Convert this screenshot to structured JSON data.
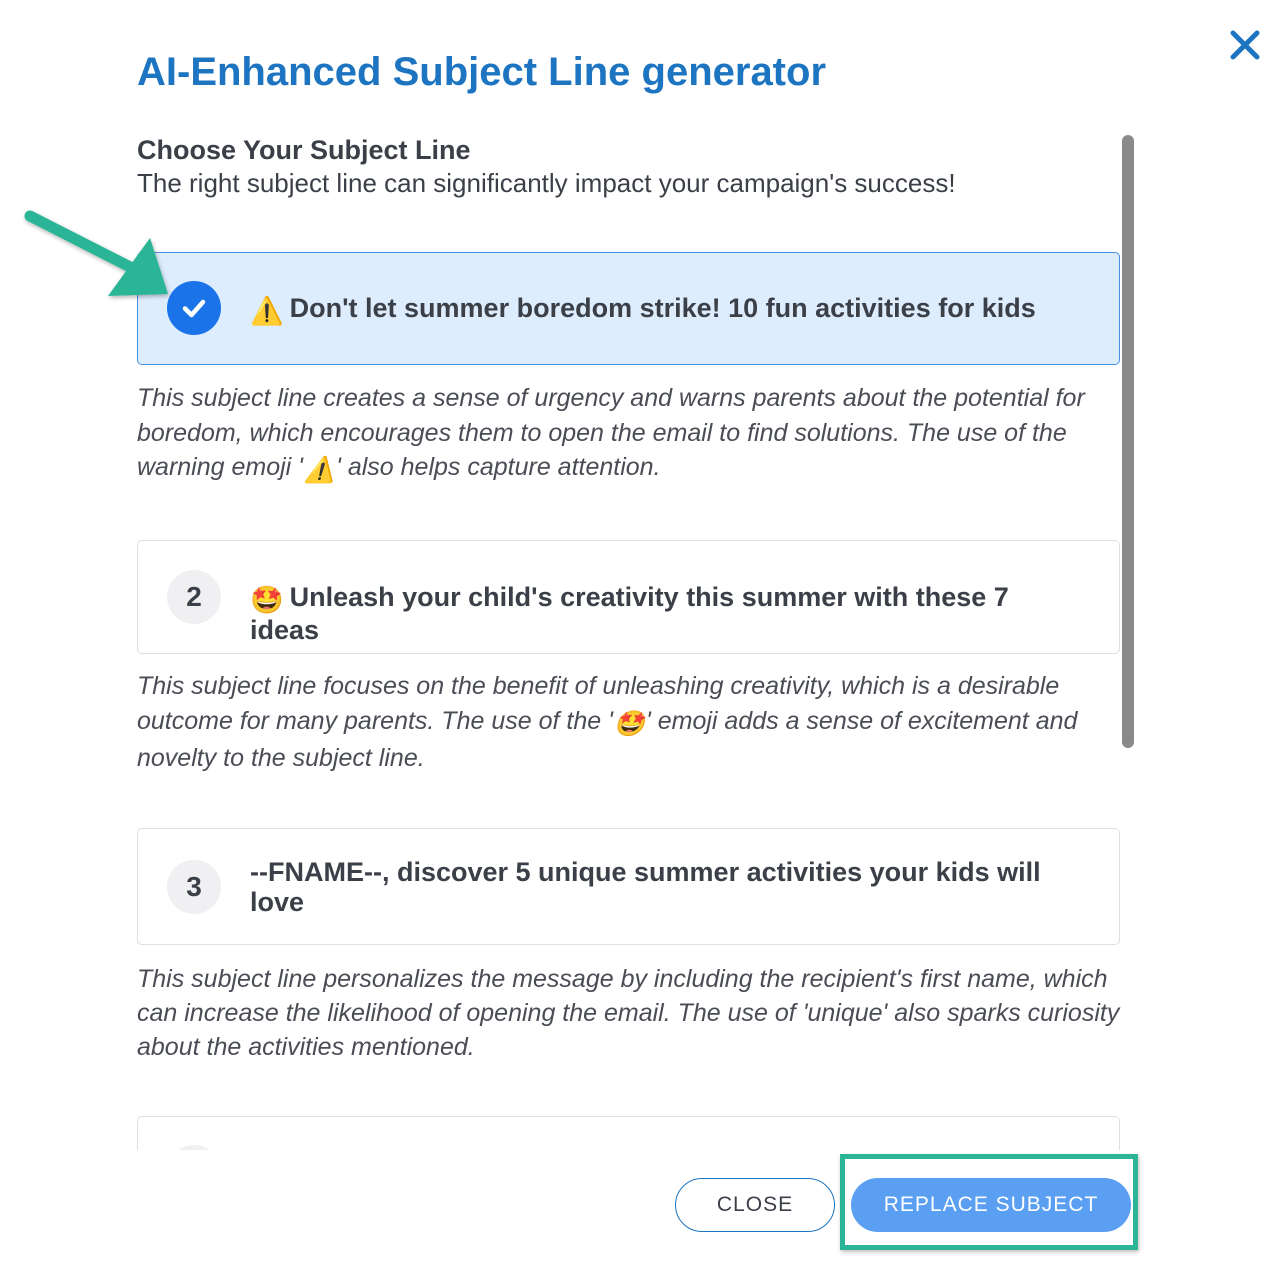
{
  "dialog": {
    "title": "AI-Enhanced Subject Line generator",
    "close_icon": "close-x-icon"
  },
  "section": {
    "title": "Choose Your Subject Line",
    "subtitle": "The right subject line can significantly impact your campaign's success!"
  },
  "options": [
    {
      "badge": "",
      "selected": true,
      "emoji": "⚠️",
      "text": "Don't let summer boredom strike! 10 fun activities for kids",
      "explanation_parts": [
        "This subject line creates a sense of urgency and warns parents about the potential for boredom, which encourages them to open the email to find solutions. The use of the warning emoji '",
        "⚠️",
        "' also helps capture attention."
      ]
    },
    {
      "badge": "2",
      "selected": false,
      "emoji": "🤩",
      "text": "Unleash your child's creativity this summer with these 7 ideas",
      "explanation_parts": [
        "This subject line focuses on the benefit of unleashing creativity, which is a desirable outcome for many parents. The use of the '",
        "🤩",
        "' emoji adds a sense of excitement and novelty to the subject line."
      ]
    },
    {
      "badge": "3",
      "selected": false,
      "emoji": "",
      "text": "--FNAME--, discover 5 unique summer activities your kids will love",
      "explanation": "This subject line personalizes the message by including the recipient's first name, which can increase the likelihood of opening the email. The use of 'unique' also sparks curiosity about the activities mentioned."
    }
  ],
  "buttons": {
    "close": "CLOSE",
    "replace": "REPLACE SUBJECT"
  },
  "colors": {
    "title": "#1d74c0",
    "selected_bg": "#deedfe",
    "check_badge": "#1a73e8",
    "replace_button": "#5a9ff2",
    "annotation": "#2bb596"
  }
}
